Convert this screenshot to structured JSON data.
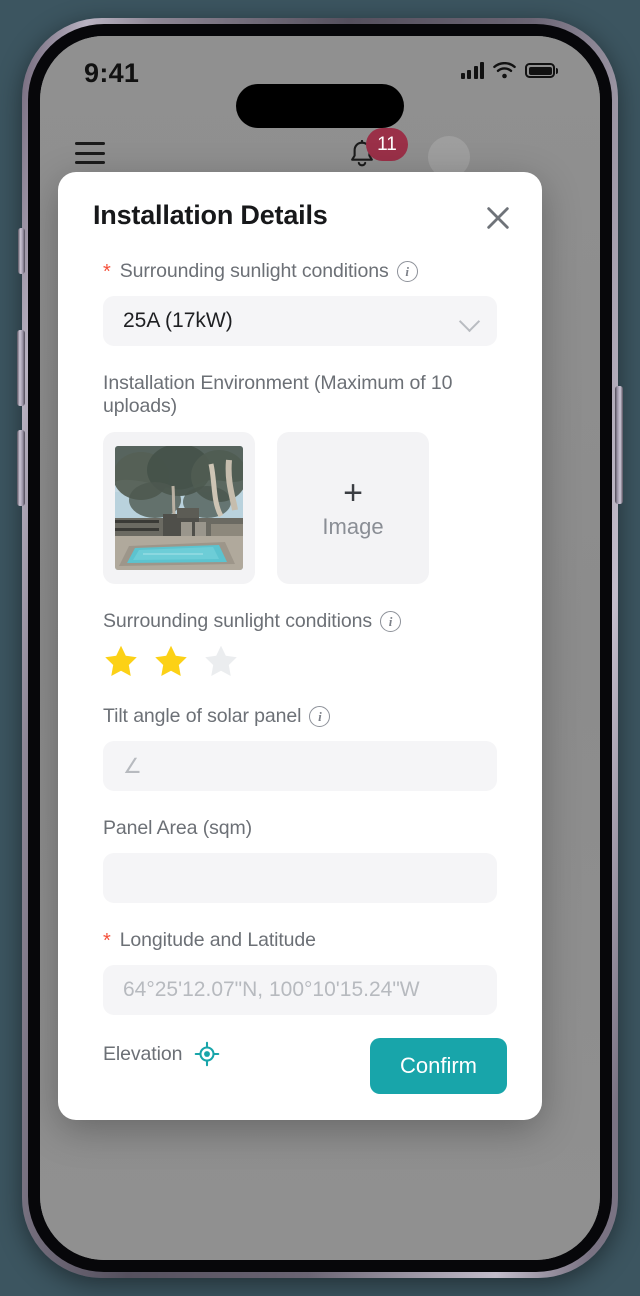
{
  "status_bar": {
    "time": "9:41",
    "signal_icon": "cellular-signal-icon",
    "wifi_icon": "wifi-icon",
    "battery_icon": "battery-full-icon"
  },
  "app_header": {
    "menu_icon": "hamburger-menu-icon",
    "notifications_icon": "bell-icon",
    "notifications_count": "11",
    "avatar": "user-avatar"
  },
  "modal": {
    "title": "Installation Details",
    "close_icon": "close-icon",
    "fields": {
      "sunlight_select": {
        "label": "Surrounding sunlight conditions",
        "required": true,
        "required_mark": "*",
        "info_icon": "info-icon",
        "value": "25A (17kW)",
        "chevron_icon": "chevron-down-icon"
      },
      "environment": {
        "label": "Installation Environment (Maximum of 10 uploads)",
        "thumbnail_alt": "pool-photo-thumbnail",
        "add_plus": "+",
        "add_label": "Image"
      },
      "sunlight_rating": {
        "label": "Surrounding sunlight conditions",
        "info_icon": "info-icon",
        "rating": 2,
        "max_rating": 3,
        "star_filled_color": "#FCD116",
        "star_empty_color": "#EBEDEF"
      },
      "tilt_angle": {
        "label": "Tilt angle of solar panel",
        "info_icon": "info-icon",
        "placeholder": "∠",
        "value": ""
      },
      "panel_area": {
        "label": "Panel Area (sqm)",
        "placeholder": "",
        "value": ""
      },
      "coordinates": {
        "label": "Longitude and Latitude",
        "required": true,
        "required_mark": "*",
        "placeholder": "64°25'12.07\"N, 100°10'15.24\"W",
        "value": ""
      },
      "elevation": {
        "label": "Elevation",
        "locate_icon": "gps-crosshair-icon",
        "locate_icon_color": "#18A5AA"
      }
    },
    "confirm_button": "Confirm"
  },
  "theme": {
    "accent": "#18A5AA",
    "badge": "#9A3048",
    "required": "#F5503A",
    "field_bg": "#F5F5F7",
    "page_bg": "#3C5560"
  }
}
